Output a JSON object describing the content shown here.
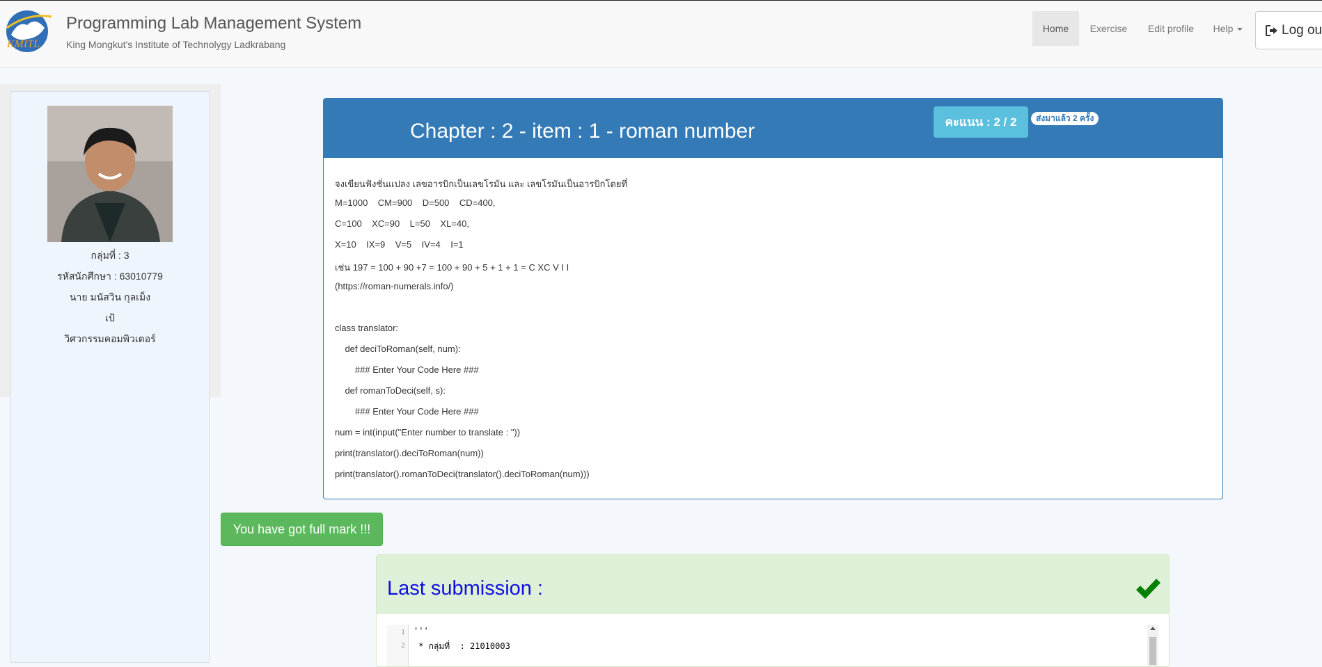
{
  "navbar": {
    "title": "Programming Lab Management System",
    "subtitle": "King Mongkut's Institute of Technolygy Ladkrabang",
    "logo_text": "KMITL",
    "items": [
      {
        "label": "Home"
      },
      {
        "label": "Exercise"
      },
      {
        "label": "Edit profile"
      },
      {
        "label": "Help"
      }
    ],
    "logout_label": "Log out"
  },
  "profile": {
    "group": "กลุ่มที่ : 3",
    "student_id": "รหัสนักศึกษา : 63010779",
    "name": "นาย มนัสวิน กุลเม็ง",
    "nickname": "เป้",
    "department": "วิศวกรรมคอมพิวเตอร์"
  },
  "exercise": {
    "title": "Chapter : 2 - item : 1 - roman number",
    "score": "คะแนน : 2 / 2",
    "sent_badge": "ส่งมาแล้ว 2 ครั้ง",
    "lines": [
      "จงเขียนฟังชั่นแปลง เลขอารบิกเป็นเลขโรมัน และ เลขโรมันเป็นอารบิกโดยที่",
      "M=1000    CM=900    D=500    CD=400,",
      "C=100    XC=90    L=50    XL=40,",
      "X=10    IX=9    V=5    IV=4    I=1",
      "เช่น 197 = 100 + 90 +7 = 100 + 90 + 5 + 1 + 1 = C XC V I I",
      "(https://roman-numerals.info/)",
      "",
      "class translator:",
      "    def deciToRoman(self, num):",
      "        ### Enter Your Code Here ###",
      "    def romanToDeci(self, s):",
      "        ### Enter Your Code Here ###",
      "num = int(input(\"Enter number to translate : \"))",
      "print(translator().deciToRoman(num))",
      "print(translator().romanToDeci(translator().deciToRoman(num)))"
    ]
  },
  "alert": {
    "full_mark": "You have got full mark !!!"
  },
  "submission": {
    "title": "Last submission :",
    "code_lines": [
      {
        "n": "1",
        "text": "'''"
      },
      {
        "n": "2",
        "text": " * กลุ่มที่  : 21010003"
      }
    ]
  },
  "colors": {
    "primary": "#337ab7",
    "info": "#5bc0de",
    "success": "#5cb85c",
    "success_bg": "#dff0d8",
    "check": "#008000"
  }
}
